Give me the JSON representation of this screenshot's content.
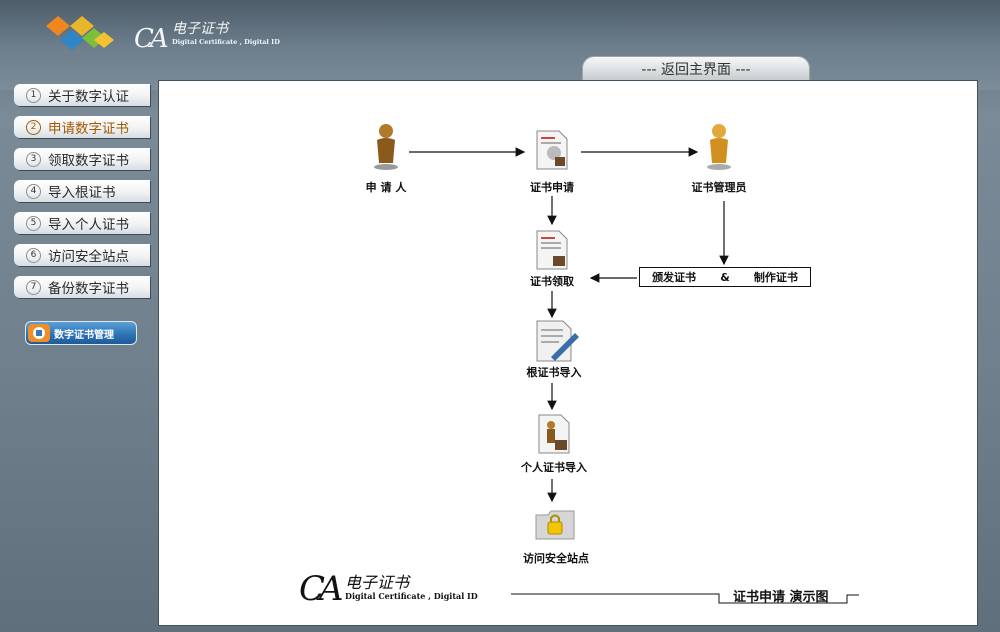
{
  "header": {
    "brand_mark": "CA",
    "brand_zh": "电子证书",
    "brand_en": "Digital Certificate , Digital ID",
    "return_label": "--- 返回主界面 ---"
  },
  "sidebar": {
    "items": [
      {
        "num": "1",
        "label": "关于数字认证"
      },
      {
        "num": "2",
        "label": "申请数字证书"
      },
      {
        "num": "3",
        "label": "领取数字证书"
      },
      {
        "num": "4",
        "label": "导入根证书"
      },
      {
        "num": "5",
        "label": "导入个人证书"
      },
      {
        "num": "6",
        "label": "访问安全站点"
      },
      {
        "num": "7",
        "label": "备份数字证书"
      }
    ],
    "active_index": 1,
    "mgmt_label": "数字证书管理"
  },
  "diagram": {
    "applicant": "申 请 人",
    "cert_apply": "证书申请",
    "cert_admin": "证书管理员",
    "cert_receive": "证书领取",
    "issue": "颁发证书",
    "amp": "&",
    "make": "制作证书",
    "root_import": "根证书导入",
    "personal_import": "个人证书导入",
    "visit_site": "访问安全站点"
  },
  "footer": {
    "brand_mark": "CA",
    "brand_zh": "电子证书",
    "brand_en": "Digital Certificate , Digital ID",
    "title": "证书申请 演示图"
  },
  "colors": {
    "accent": "#a35a00",
    "frame": "#6f7f8c",
    "button": "#2f74b6"
  }
}
